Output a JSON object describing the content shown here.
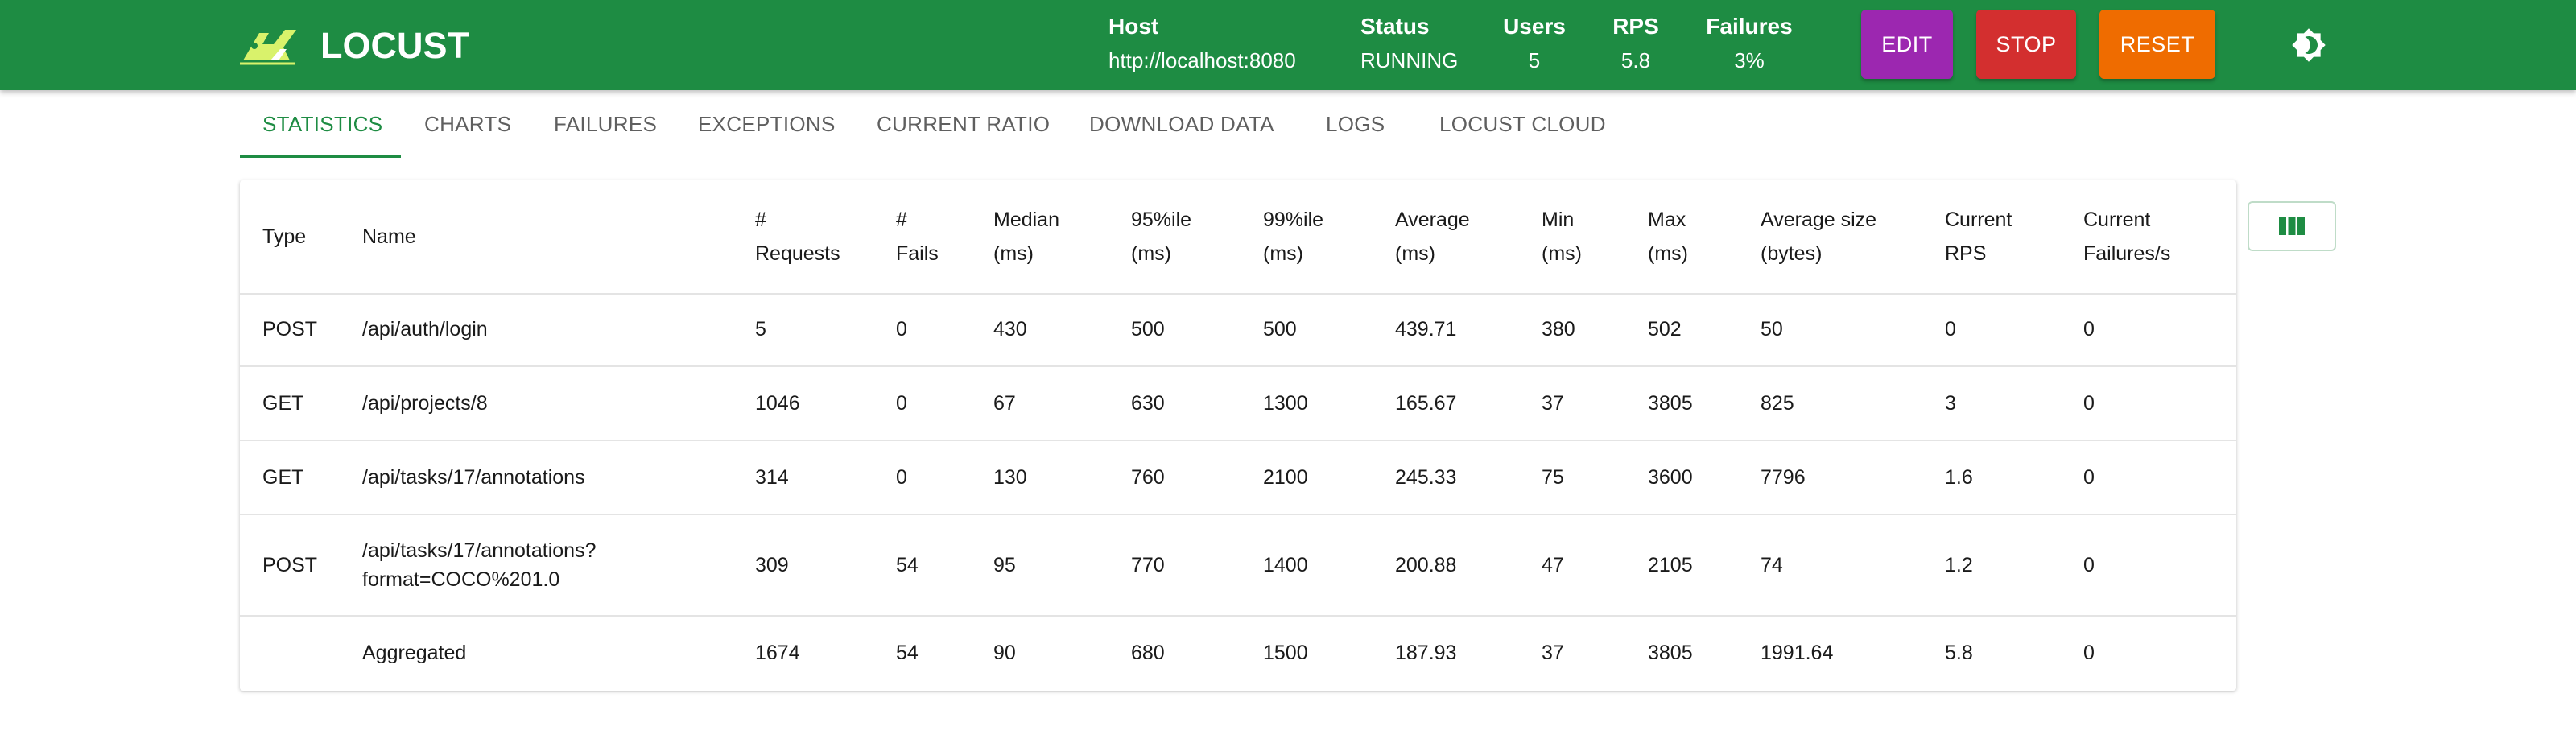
{
  "app": {
    "name": "LOCUST"
  },
  "header": {
    "host": {
      "label": "Host",
      "value": "http://localhost:8080"
    },
    "status": {
      "label": "Status",
      "value": "RUNNING"
    },
    "users": {
      "label": "Users",
      "value": "5"
    },
    "rps": {
      "label": "RPS",
      "value": "5.8"
    },
    "failures": {
      "label": "Failures",
      "value": "3%"
    },
    "buttons": {
      "edit": "EDIT",
      "stop": "STOP",
      "reset": "RESET"
    },
    "theme_icon": "brightness-icon"
  },
  "tabs": [
    {
      "label": "STATISTICS",
      "active": true
    },
    {
      "label": "CHARTS",
      "active": false
    },
    {
      "label": "FAILURES",
      "active": false
    },
    {
      "label": "EXCEPTIONS",
      "active": false
    },
    {
      "label": "CURRENT RATIO",
      "active": false
    },
    {
      "label": "DOWNLOAD DATA",
      "active": false
    },
    {
      "label": "LOGS",
      "active": false
    },
    {
      "label": "LOCUST CLOUD",
      "active": false
    }
  ],
  "table": {
    "columns": [
      {
        "line1": "Type",
        "line2": ""
      },
      {
        "line1": "Name",
        "line2": ""
      },
      {
        "line1": "#",
        "line2": "Requests"
      },
      {
        "line1": "#",
        "line2": "Fails"
      },
      {
        "line1": "Median",
        "line2": "(ms)"
      },
      {
        "line1": "95%ile",
        "line2": "(ms)"
      },
      {
        "line1": "99%ile",
        "line2": "(ms)"
      },
      {
        "line1": "Average",
        "line2": "(ms)"
      },
      {
        "line1": "Min",
        "line2": "(ms)"
      },
      {
        "line1": "Max",
        "line2": "(ms)"
      },
      {
        "line1": "Average size",
        "line2": "(bytes)"
      },
      {
        "line1": "Current",
        "line2": "RPS"
      },
      {
        "line1": "Current",
        "line2": "Failures/s"
      }
    ],
    "rows": [
      {
        "type": "POST",
        "name_line1": "/api/auth/login",
        "name_line2": "",
        "requests": "5",
        "fails": "0",
        "median": "430",
        "p95": "500",
        "p99": "500",
        "average": "439.71",
        "min": "380",
        "max": "502",
        "avg_size": "50",
        "current_rps": "0",
        "current_failures": "0"
      },
      {
        "type": "GET",
        "name_line1": "/api/projects/8",
        "name_line2": "",
        "requests": "1046",
        "fails": "0",
        "median": "67",
        "p95": "630",
        "p99": "1300",
        "average": "165.67",
        "min": "37",
        "max": "3805",
        "avg_size": "825",
        "current_rps": "3",
        "current_failures": "0"
      },
      {
        "type": "GET",
        "name_line1": "/api/tasks/17/annotations",
        "name_line2": "",
        "requests": "314",
        "fails": "0",
        "median": "130",
        "p95": "760",
        "p99": "2100",
        "average": "245.33",
        "min": "75",
        "max": "3600",
        "avg_size": "7796",
        "current_rps": "1.6",
        "current_failures": "0"
      },
      {
        "type": "POST",
        "name_line1": "/api/tasks/17/annotations?",
        "name_line2": "format=COCO%201.0",
        "requests": "309",
        "fails": "54",
        "median": "95",
        "p95": "770",
        "p99": "1400",
        "average": "200.88",
        "min": "47",
        "max": "2105",
        "avg_size": "74",
        "current_rps": "1.2",
        "current_failures": "0"
      },
      {
        "type": "",
        "name_line1": "Aggregated",
        "name_line2": "",
        "requests": "1674",
        "fails": "54",
        "median": "90",
        "p95": "680",
        "p99": "1500",
        "average": "187.93",
        "min": "37",
        "max": "3805",
        "avg_size": "1991.64",
        "current_rps": "5.8",
        "current_failures": "0"
      }
    ]
  },
  "column_selector_icon": "view-columns-icon",
  "colors": {
    "brand": "#1e8c43",
    "edit": "#9c27b0",
    "stop": "#d32f2f",
    "reset": "#ef6c00"
  }
}
